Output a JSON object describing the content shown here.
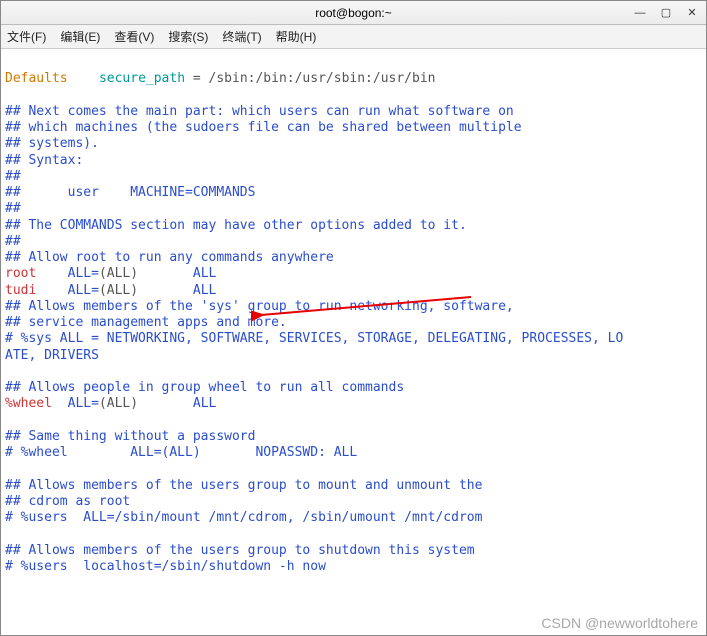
{
  "window": {
    "title": "root@bogon:~"
  },
  "menu": {
    "file": "文件(F)",
    "edit": "编辑(E)",
    "view": "查看(V)",
    "search": "搜索(S)",
    "terminal": "终端(T)",
    "help": "帮助(H)"
  },
  "lines": {
    "defaults_kw": "Defaults",
    "secure_path_kw": "secure_path",
    "eq": " = ",
    "secure_path_val": "/sbin:/bin:/usr/sbin:/usr/bin",
    "c1": "## Next comes the main part: which users can run what software on",
    "c2": "## which machines (the sudoers file can be shared between multiple",
    "c3": "## systems).",
    "c4": "## Syntax:",
    "c5": "##",
    "c6": "##      user    MACHINE=COMMANDS",
    "c7": "##",
    "c8": "## The COMMANDS section may have other options added to it.",
    "c9": "##",
    "c10": "## Allow root to run any commands anywhere",
    "root_user": "root",
    "root_spec_1": "    ALL=",
    "root_spec_paren": "(ALL)",
    "root_spec_2": "       ALL",
    "tudi_user": "tudi",
    "tudi_spec_1": "    ALL=",
    "tudi_spec_paren": "(ALL)",
    "tudi_spec_2": "       ALL",
    "c11": "## Allows members of the 'sys' group to run networking, software,",
    "c12": "## service management apps and more.",
    "c13": "# %sys ALL = NETWORKING, SOFTWARE, SERVICES, STORAGE, DELEGATING, PROCESSES, LO",
    "c13b": "ATE, DRIVERS",
    "c14": "## Allows people in group wheel to run all commands",
    "wheel_user": "%wheel",
    "wheel_spec_1": "  ALL=",
    "wheel_spec_paren": "(ALL)",
    "wheel_spec_2": "       ALL",
    "c15": "## Same thing without a password",
    "c16": "# %wheel        ALL=(ALL)       NOPASSWD: ALL",
    "c17": "## Allows members of the users group to mount and unmount the",
    "c18": "## cdrom as root",
    "c19": "# %users  ALL=/sbin/mount /mnt/cdrom, /sbin/umount /mnt/cdrom",
    "c20": "## Allows members of the users group to shutdown this system",
    "c21": "# %users  localhost=/sbin/shutdown -h now"
  },
  "watermark": "CSDN @newworldtohere"
}
